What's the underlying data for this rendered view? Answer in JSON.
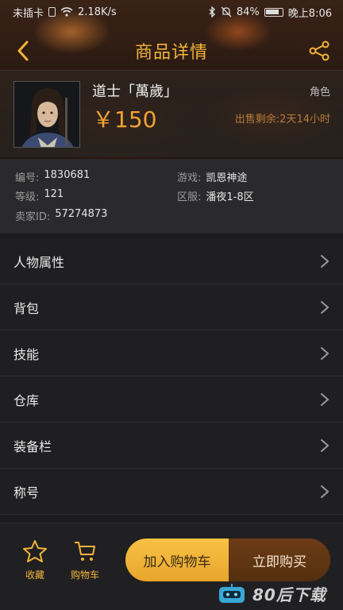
{
  "status_bar": {
    "carrier": "未插卡",
    "network_speed": "2.18K/s",
    "battery": "84%",
    "time": "晚上8:06"
  },
  "nav": {
    "title": "商品详情",
    "back_icon": "chevron-left-icon",
    "share_icon": "share-icon"
  },
  "product": {
    "name": "道士「萬歲」",
    "type": "角色",
    "price": "￥150",
    "time_left": "出售剩余:2天14小时"
  },
  "info": {
    "id_label": "编号:",
    "id_value": "1830681",
    "game_label": "游戏:",
    "game_value": "凯恩神途",
    "level_label": "等级:",
    "level_value": "121",
    "server_label": "区服:",
    "server_value": "潘夜1-8区",
    "seller_label": "卖家ID:",
    "seller_value": "57274873"
  },
  "menu": {
    "items": [
      {
        "label": "人物属性"
      },
      {
        "label": "背包"
      },
      {
        "label": "技能"
      },
      {
        "label": "仓库"
      },
      {
        "label": "装备栏"
      },
      {
        "label": "称号"
      }
    ]
  },
  "bottom": {
    "favorite_label": "收藏",
    "cart_label": "购物车",
    "add_to_cart_label": "加入购物车",
    "buy_now_label": "立即购买"
  },
  "watermark": {
    "text": "80后下载"
  },
  "colors": {
    "accent": "#f2b43a",
    "price": "#f2a233",
    "buy_button": "#5e3412"
  }
}
